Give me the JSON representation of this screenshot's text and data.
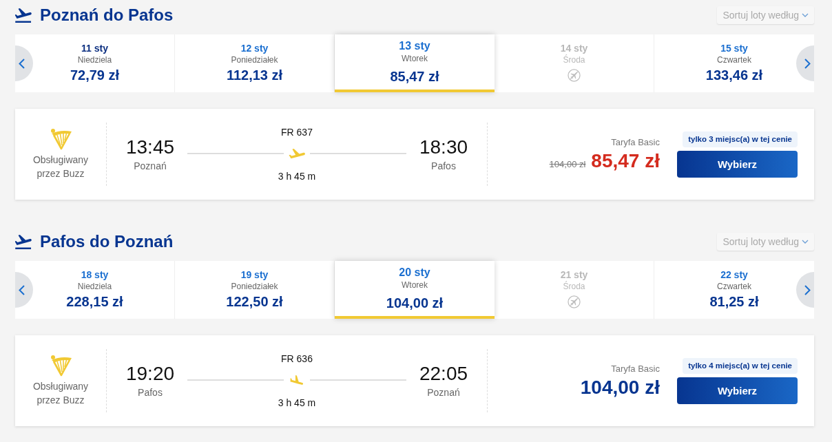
{
  "sections": [
    {
      "title": "Poznań do Pafos",
      "sort": {
        "placeholder": "Sortuj loty według"
      },
      "dates": [
        {
          "date": "11 sty",
          "day": "Niedziela",
          "price": "72,79 zł",
          "available": true,
          "hovered": true,
          "selected": false
        },
        {
          "date": "12 sty",
          "day": "Poniedziałek",
          "price": "112,13 zł",
          "available": true,
          "hovered": false,
          "selected": false
        },
        {
          "date": "13 sty",
          "day": "Wtorek",
          "price": "85,47 zł",
          "available": true,
          "hovered": false,
          "selected": true
        },
        {
          "date": "14 sty",
          "day": "Środa",
          "available": false,
          "hovered": false,
          "selected": false
        },
        {
          "date": "15 sty",
          "day": "Czwartek",
          "price": "133,46 zł",
          "available": true,
          "hovered": false,
          "selected": false
        }
      ],
      "flight": {
        "operator": "Obsługiwany przez Buzz",
        "number": "FR 637",
        "departure": {
          "time": "13:45",
          "city": "Poznań"
        },
        "arrival": {
          "time": "18:30",
          "city": "Pafos"
        },
        "duration": "3 h 45 m",
        "fare": "Taryfa Basic",
        "old_price": "104,00 zł",
        "price": "85,47 zł",
        "discounted": true,
        "seats_note": "tylko 3 miejsc(a) w tej cenie",
        "button": "Wybierz"
      }
    },
    {
      "title": "Pafos do Poznań",
      "sort": {
        "placeholder": "Sortuj loty według"
      },
      "dates": [
        {
          "date": "18 sty",
          "day": "Niedziela",
          "price": "228,15 zł",
          "available": true,
          "hovered": false,
          "selected": false
        },
        {
          "date": "19 sty",
          "day": "Poniedziałek",
          "price": "122,50 zł",
          "available": true,
          "hovered": false,
          "selected": false
        },
        {
          "date": "20 sty",
          "day": "Wtorek",
          "price": "104,00 zł",
          "available": true,
          "hovered": false,
          "selected": true
        },
        {
          "date": "21 sty",
          "day": "Środa",
          "available": false,
          "hovered": false,
          "selected": false
        },
        {
          "date": "22 sty",
          "day": "Czwartek",
          "price": "81,25 zł",
          "available": true,
          "hovered": false,
          "selected": false
        }
      ],
      "flight": {
        "operator": "Obsługiwany przez Buzz",
        "number": "FR 636",
        "departure": {
          "time": "19:20",
          "city": "Pafos"
        },
        "arrival": {
          "time": "22:05",
          "city": "Poznań"
        },
        "duration": "3 h 45 m",
        "fare": "Taryfa Basic",
        "price": "104,00 zł",
        "discounted": false,
        "seats_note": "tylko 4 miejsc(a) w tej cenie",
        "button": "Wybierz"
      }
    }
  ]
}
